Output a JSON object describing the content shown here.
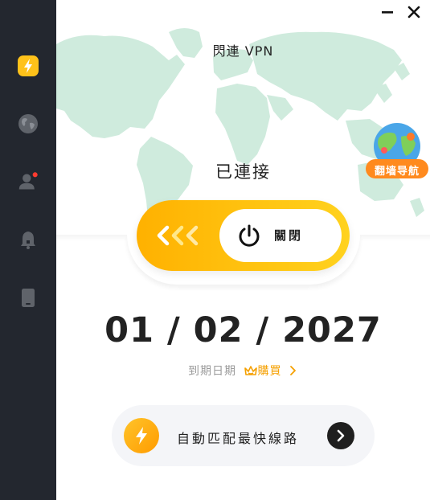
{
  "app": {
    "title": "閃連 VPN"
  },
  "status": {
    "text": "已連接"
  },
  "toggle": {
    "state_label": "關閉"
  },
  "subscription": {
    "expiry_date": "01 / 02 / 2027",
    "expiry_label": "到期日期",
    "buy_label": "購買"
  },
  "route": {
    "label": "自動匹配最快線路"
  },
  "badge": {
    "label": "翻墙导航"
  },
  "sidebar": {
    "items": [
      {
        "name": "lightning",
        "icon": "lightning-icon",
        "active": true
      },
      {
        "name": "globe",
        "icon": "globe-icon"
      },
      {
        "name": "user",
        "icon": "user-icon",
        "notification_dot": true
      },
      {
        "name": "notifications",
        "icon": "bell-icon"
      },
      {
        "name": "device",
        "icon": "phone-icon"
      }
    ]
  },
  "colors": {
    "accent": "#FFC21A",
    "sidebar_bg": "#23272F",
    "map": "#CFEBDD",
    "buy": "#F5A000",
    "notification": "#FF3B30"
  }
}
